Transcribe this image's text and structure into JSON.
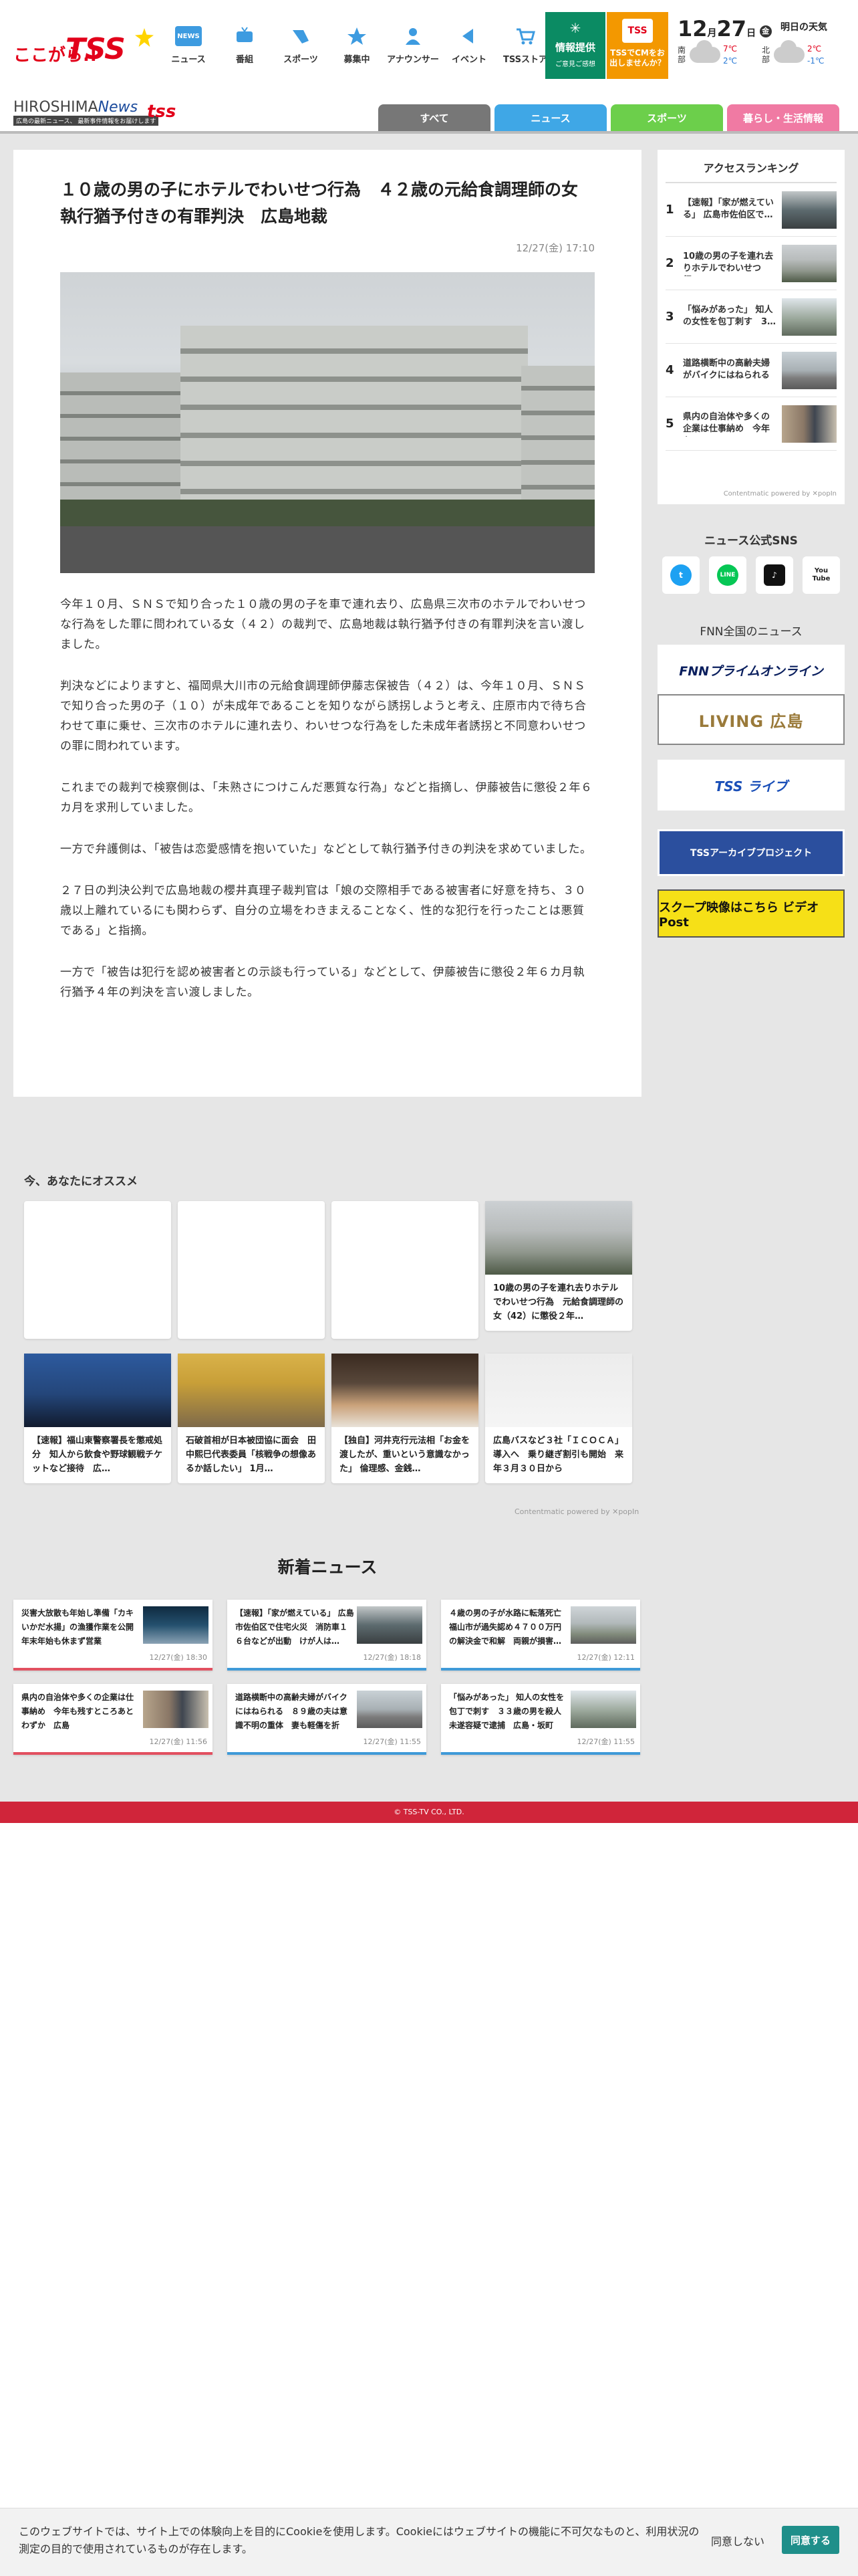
{
  "header": {
    "logo_text_1": "ここがら.!",
    "logo_text_2": "TSS",
    "nav": [
      {
        "label": "ニュース",
        "icon": "news-icon"
      },
      {
        "label": "番組",
        "icon": "tv-icon"
      },
      {
        "label": "スポーツ",
        "icon": "sports-icon"
      },
      {
        "label": "募集中",
        "icon": "star-icon"
      },
      {
        "label": "アナウンサー",
        "icon": "announcer-icon"
      },
      {
        "label": "イベント",
        "icon": "flag-icon"
      },
      {
        "label": "TSSストア",
        "icon": "cart-icon"
      }
    ],
    "news_badge": "NEWS",
    "info_button": {
      "label": "情報提供",
      "sub": "ご意見ご感想"
    },
    "promo": {
      "badge": "TSS",
      "text": "TSSでCMをお出しませんか？"
    },
    "date": {
      "month": "12",
      "month_suffix": "月",
      "day": "27",
      "day_suffix": "日",
      "weekday": "金"
    },
    "tomorrow_label": "明日の天気",
    "weather": [
      {
        "region": "南部",
        "hi": "7℃",
        "lo": "2℃"
      },
      {
        "region": "北部",
        "hi": "2℃",
        "lo": "-1℃"
      }
    ]
  },
  "subbar": {
    "brand_1": "HIROSHIMA",
    "brand_2": "News",
    "brand_tss": "tss",
    "brand_tagline": "広島の最新ニュース、 最新事件情報をお届けします",
    "tabs": [
      {
        "label": "すべて",
        "color": "#777777"
      },
      {
        "label": "ニュース",
        "color": "#3fa7e6"
      },
      {
        "label": "スポーツ",
        "color": "#6ccf4b"
      },
      {
        "label": "暮らし・生活情報",
        "color": "#f07aa3"
      }
    ]
  },
  "article": {
    "title": "１０歳の男の子にホテルでわいせつ行為　４２歳の元給食調理師の女　執行猶予付きの有罪判決　広島地裁",
    "date": "12/27(金) 17:10",
    "paragraphs": [
      "今年１０月、ＳＮＳで知り合った１０歳の男の子を車で連れ去り、広島県三次市のホテルでわいせつな行為をした罪に問われている女（４２）の裁判で、広島地裁は執行猶予付きの有罪判決を言い渡しました。",
      "判決などによりますと、福岡県大川市の元給食調理師伊藤志保被告（４２）は、今年１０月、ＳＮＳで知り合った男の子（１０）が未成年であることを知りながら誘拐しようと考え、庄原市内で待ち合わせて車に乗せ、三次市のホテルに連れ去り、わいせつな行為をした未成年者誘拐と不同意わいせつの罪に問われています。",
      "これまでの裁判で検察側は、「未熟さにつけこんだ悪質な行為」などと指摘し、伊藤被告に懲役２年６カ月を求刑していました。",
      "一方で弁護側は、「被告は恋愛感情を抱いていた」などとして執行猶予付きの判決を求めていました。",
      "２７日の判決公判で広島地裁の櫻井真理子裁判官は「娘の交際相手である被害者に好意を持ち、３０歳以上離れているにも関わらず、自分の立場をわきまえることなく、性的な犯行を行ったことは悪質である」と指摘。",
      "一方で「被告は犯行を認め被害者との示談も行っている」などとして、伊藤被告に懲役２年６カ月執行猶予４年の判決を言い渡しました。"
    ]
  },
  "ranking": {
    "title": "アクセスランキング",
    "items": [
      {
        "num": "1",
        "text": "【速報】「家が燃えている」 広島市佐伯区で…"
      },
      {
        "num": "2",
        "text": "10歳の男の子を連れ去りホテルでわいせつ行…"
      },
      {
        "num": "3",
        "text": "「悩みがあった」 知人の女性を包丁刺す　3…"
      },
      {
        "num": "4",
        "text": "道路横断中の高齢夫婦がバイクにはねられる …"
      },
      {
        "num": "5",
        "text": "県内の自治体や多くの企業は仕事納め　今年も…"
      }
    ],
    "powered": "Contentmatic powered by ✕popIn"
  },
  "sns": {
    "title": "ニュース公式SNS",
    "items": [
      {
        "name": "twitter-icon",
        "label": "t",
        "color": "#1da1f2"
      },
      {
        "name": "line-icon",
        "label": "LINE",
        "color": "#06c755"
      },
      {
        "name": "tiktok-icon",
        "label": "♪",
        "color": "#111111"
      },
      {
        "name": "youtube-icon",
        "label": "You Tube",
        "color": "#ffffff"
      }
    ]
  },
  "fnn": {
    "title": "FNN全国のニュース",
    "banners": [
      "FNNプライムオンライン",
      "LIVING 広島",
      "TSS ライブ",
      "TSSアーカイブプロジェクト",
      "スクープ映像はこちら ビデオPost"
    ]
  },
  "recommend": {
    "title": "今、あなたにオススメ",
    "cards": [
      {
        "text": ""
      },
      {
        "text": ""
      },
      {
        "text": ""
      },
      {
        "text": "10歳の男の子を連れ去りホテルでわいせつ行為　元給食調理師の女（42）に懲役２年…"
      },
      {
        "text": "【速報】福山東警察署長を懲戒処分　知人から飲食や野球観戦チケットなど接待　広…"
      },
      {
        "text": "石破首相が日本被団協に面会　田中熙巳代表委員「核戦争の想像あるか話したい」 1月…"
      },
      {
        "text": "【独自】河井克行元法相「お金を渡したが、重いという意識なかった」 倫理感、金銭…"
      },
      {
        "text": "広島バスなど３社「ＩＣＯＣＡ」導入へ　乗り継ぎ割引も開始　来年３月３０日から"
      }
    ],
    "powered": "Contentmatic powered by ✕popIn"
  },
  "new_news": {
    "title": "新着ニュース",
    "items": [
      {
        "text": "災害大放散も年始し準備「カキいかだ水揚」の漁獲作業を公開　年末年始も休まず営業",
        "date": "12/27(金) 18:30"
      },
      {
        "text": "【速報】「家が燃えている」 広島市佐伯区で住宅火災　消防車１６台などが出動　けが人は…",
        "date": "12/27(金) 18:18"
      },
      {
        "text": "４歳の男の子が水路に転落死亡　福山市が過失認め４７００万円の解決金で和解　両親が損害…",
        "date": "12/27(金) 12:11"
      },
      {
        "text": "県内の自治体や多くの企業は仕事納め　今年も残すところあとわずか　広島",
        "date": "12/27(金) 11:56"
      },
      {
        "text": "道路横断中の高齢夫婦がバイクにはねられる　８９歳の夫は意識不明の重体　妻も軽傷を折る…",
        "date": "12/27(金) 11:55"
      },
      {
        "text": "「悩みがあった」 知人の女性を包丁で刺す　３３歳の男を殺人未遂容疑で逮捕　広島・坂町",
        "date": "12/27(金) 11:55"
      }
    ]
  },
  "footer": {
    "copyright": "© TSS-TV CO., LTD."
  },
  "cookie": {
    "text": "このウェブサイトでは、サイト上での体験向上を目的にCookieを使用します。Cookieにはウェブサイトの機能に不可欠なものと、利用状況の測定の目的で使用されているものが存在します。",
    "deny": "同意しない",
    "agree": "同意する"
  }
}
